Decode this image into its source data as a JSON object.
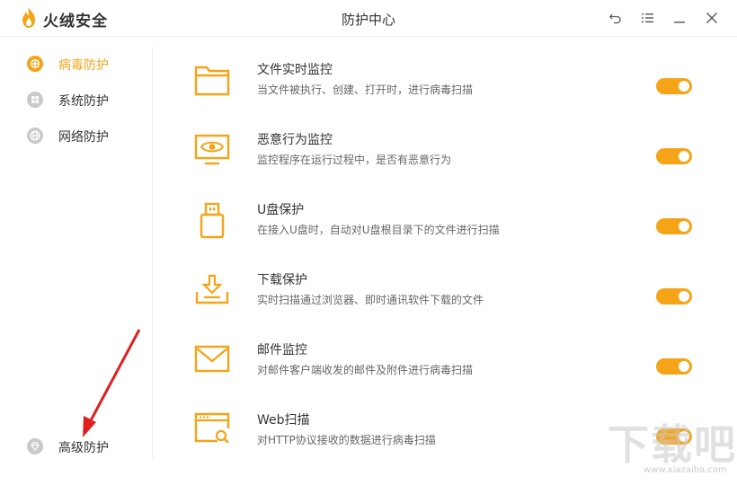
{
  "app": {
    "name": "火绒安全",
    "window_title": "防护中心",
    "accent_color": "#f5a417"
  },
  "window_controls": [
    {
      "name": "back-icon"
    },
    {
      "name": "menu-icon"
    },
    {
      "name": "minimize-icon"
    },
    {
      "name": "close-icon"
    }
  ],
  "sidebar": {
    "items": [
      {
        "label": "病毒防护",
        "icon": "virus-shield-icon",
        "active": true
      },
      {
        "label": "系统防护",
        "icon": "windows-icon",
        "active": false
      },
      {
        "label": "网络防护",
        "icon": "network-icon",
        "active": false
      }
    ],
    "bottom_item": {
      "label": "高级防护",
      "icon": "diamond-icon"
    }
  },
  "features": [
    {
      "title": "文件实时监控",
      "desc": "当文件被执行、创建、打开时，进行病毒扫描",
      "icon": "folder-icon",
      "enabled": true
    },
    {
      "title": "恶意行为监控",
      "desc": "监控程序在运行过程中，是否有恶意行为",
      "icon": "monitor-eye-icon",
      "enabled": true
    },
    {
      "title": "U盘保护",
      "desc": "在接入U盘时，自动对U盘根目录下的文件进行扫描",
      "icon": "usb-drive-icon",
      "enabled": true
    },
    {
      "title": "下载保护",
      "desc": "实时扫描通过浏览器、即时通讯软件下载的文件",
      "icon": "download-icon",
      "enabled": true
    },
    {
      "title": "邮件监控",
      "desc": "对邮件客户端收发的邮件及附件进行病毒扫描",
      "icon": "mail-icon",
      "enabled": true
    },
    {
      "title": "Web扫描",
      "desc": "对HTTP协议接收的数据进行病毒扫描",
      "icon": "web-scan-icon",
      "enabled": true
    }
  ],
  "watermark": {
    "text": "下载吧",
    "sub": "www.xiazaiba.com"
  }
}
